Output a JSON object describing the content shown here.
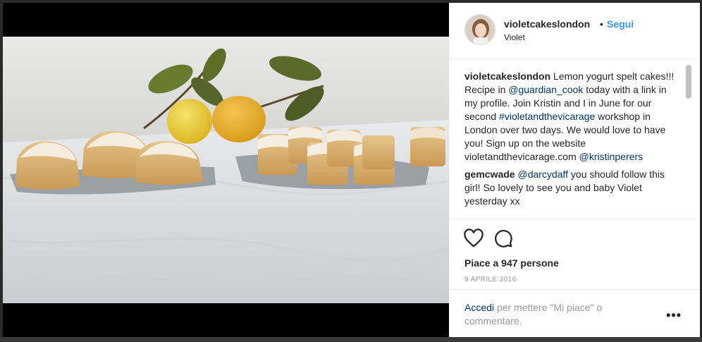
{
  "post": {
    "image_alt": "Lemon yogurt spelt cakes on grey platters with lemons and leaves on a white tablecloth"
  },
  "header": {
    "username": "violetcakeslondon",
    "separator": "•",
    "follow_label": "Segui",
    "location": "Violet"
  },
  "caption": {
    "username": "violetcakeslondon",
    "text_1": " Lemon yogurt spelt cakes!!! Recipe in ",
    "mention_1": "@guardian_cook",
    "text_2": " today with a link in my profile. Join Kristin and I in June for our second ",
    "hashtag_1": "#violetandthevicarage",
    "text_3": " workshop in London over two days. We would love to have you! Sign up on the website violetandthevicarage.com ",
    "mention_2": "@kristinperers"
  },
  "comment": {
    "username": "gemcwade",
    "mention": "@darcydaff",
    "text": " you should follow this girl! So lovely to see you and baby Violet yesterday xx"
  },
  "actions": {
    "like_icon": "heart-icon",
    "comment_icon": "comment-icon",
    "likes_text": "Piace a 947 persone",
    "date": "9 APRILE 2016"
  },
  "footer": {
    "login_link": "Accedi",
    "login_text": " per mettere \"Mi piace\" o commentare.",
    "more_label": "•••"
  },
  "colors": {
    "link_blue": "#3897f0",
    "mention_blue": "#003569",
    "text": "#262626",
    "muted": "#999999"
  }
}
